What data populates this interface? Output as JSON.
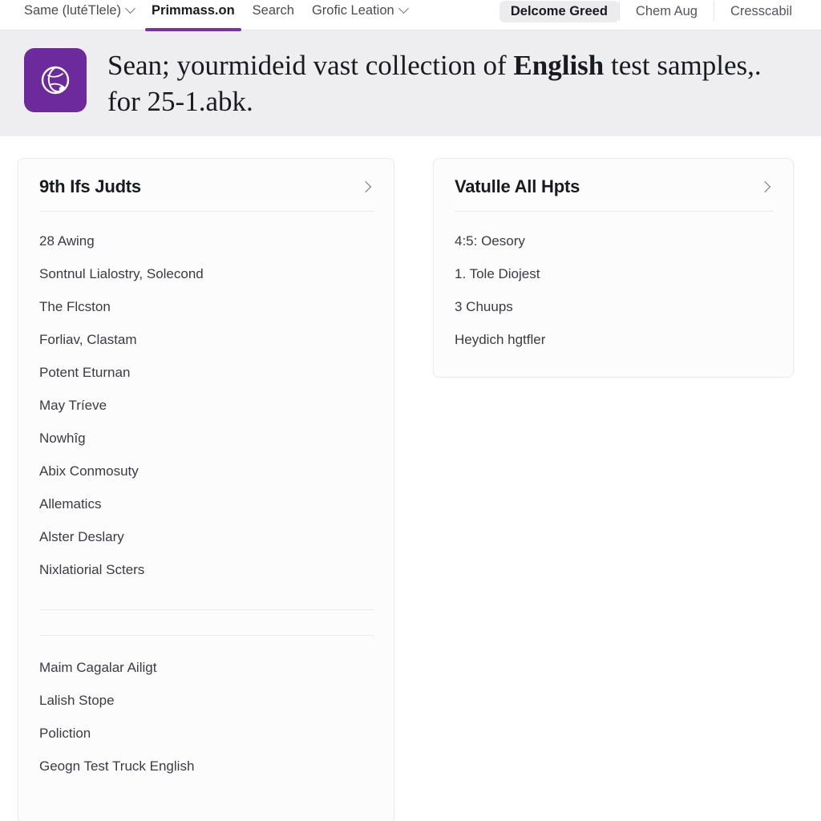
{
  "colors": {
    "accent_purple": "#7b2fa8",
    "icon_tile_purple": "#6d2a9c",
    "banner_bg": "#eeeef1",
    "card_bg": "#fcfcfd",
    "border": "#eaeaee",
    "text_primary": "#1a1b20",
    "text_secondary": "#3a3b43"
  },
  "topnav": {
    "left_items": [
      {
        "label": "Same (lutéTlele)",
        "icon": "chevron-down-icon",
        "has_chevron": true,
        "active": false
      },
      {
        "label": "Primmass.on",
        "has_chevron": false,
        "active": true
      },
      {
        "label": "Search",
        "has_chevron": false,
        "active": false
      },
      {
        "label": "Grofic Leation",
        "icon": "chevron-down-icon",
        "has_chevron": true,
        "active": false
      }
    ],
    "right_items": [
      {
        "label": "Delcome Greed",
        "style": "pill"
      },
      {
        "label": "Chem Aug",
        "style": "plain"
      },
      {
        "label": "Cresscabil",
        "style": "plain"
      }
    ]
  },
  "banner": {
    "icon": "globe-icon",
    "text_before": "Sean; yourmideid vast collection of ",
    "text_bold": "English",
    "text_after": " test samples,. for 25-1.abk."
  },
  "left_card": {
    "title": "9th Ifs Judts",
    "chevron": "chevron-right-icon",
    "group_one": [
      "28 Awing",
      "Sontnul Lialostry, Solecond",
      "The Flcston",
      "Forliav, Clastam",
      "Potent Eturnan",
      "May Tríeve",
      "Nowhîg",
      "Abix Conmosuty",
      "Allematics",
      "Alster Deslary",
      "Nixlatiorial Scters"
    ],
    "group_two": [
      "Maim Cagalar Ailigt",
      "Lalish Stope",
      "Poliction",
      "Geogn Test Truck English"
    ]
  },
  "right_card": {
    "title": "Vatulle All Hpts",
    "chevron": "chevron-right-icon",
    "items": [
      "4:5: Oesory",
      "1. Tole Diojest",
      "3 Chuups",
      "Heydich hgtfler"
    ]
  }
}
